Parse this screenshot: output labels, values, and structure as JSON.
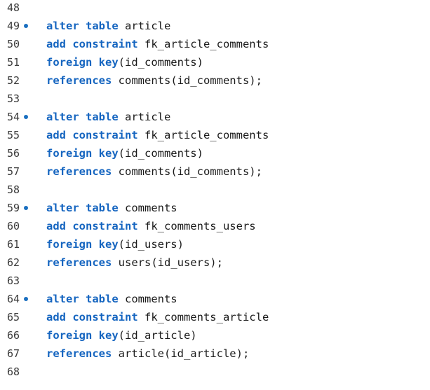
{
  "lines": [
    {
      "num": "48",
      "marker": false,
      "tokens": []
    },
    {
      "num": "49",
      "marker": true,
      "tokens": [
        {
          "t": "kw",
          "v": "alter table"
        },
        {
          "t": "id",
          "v": " article"
        }
      ]
    },
    {
      "num": "50",
      "marker": false,
      "tokens": [
        {
          "t": "kw",
          "v": "add constraint"
        },
        {
          "t": "id",
          "v": " fk_article_comments"
        }
      ]
    },
    {
      "num": "51",
      "marker": false,
      "tokens": [
        {
          "t": "kw",
          "v": "foreign key"
        },
        {
          "t": "id",
          "v": "(id_comments)"
        }
      ]
    },
    {
      "num": "52",
      "marker": false,
      "tokens": [
        {
          "t": "kw",
          "v": "references"
        },
        {
          "t": "id",
          "v": " comments(id_comments);"
        }
      ]
    },
    {
      "num": "53",
      "marker": false,
      "tokens": []
    },
    {
      "num": "54",
      "marker": true,
      "tokens": [
        {
          "t": "kw",
          "v": "alter table"
        },
        {
          "t": "id",
          "v": " article"
        }
      ]
    },
    {
      "num": "55",
      "marker": false,
      "tokens": [
        {
          "t": "kw",
          "v": "add constraint"
        },
        {
          "t": "id",
          "v": " fk_article_comments"
        }
      ]
    },
    {
      "num": "56",
      "marker": false,
      "tokens": [
        {
          "t": "kw",
          "v": "foreign key"
        },
        {
          "t": "id",
          "v": "(id_comments)"
        }
      ]
    },
    {
      "num": "57",
      "marker": false,
      "tokens": [
        {
          "t": "kw",
          "v": "references"
        },
        {
          "t": "id",
          "v": " comments(id_comments);"
        }
      ]
    },
    {
      "num": "58",
      "marker": false,
      "tokens": []
    },
    {
      "num": "59",
      "marker": true,
      "tokens": [
        {
          "t": "kw",
          "v": "alter table"
        },
        {
          "t": "id",
          "v": " comments"
        }
      ]
    },
    {
      "num": "60",
      "marker": false,
      "tokens": [
        {
          "t": "kw",
          "v": "add constraint"
        },
        {
          "t": "id",
          "v": " fk_comments_users"
        }
      ]
    },
    {
      "num": "61",
      "marker": false,
      "tokens": [
        {
          "t": "kw",
          "v": "foreign key"
        },
        {
          "t": "id",
          "v": "(id_users)"
        }
      ]
    },
    {
      "num": "62",
      "marker": false,
      "tokens": [
        {
          "t": "kw",
          "v": "references"
        },
        {
          "t": "id",
          "v": " users(id_users);"
        }
      ]
    },
    {
      "num": "63",
      "marker": false,
      "tokens": []
    },
    {
      "num": "64",
      "marker": true,
      "tokens": [
        {
          "t": "kw",
          "v": "alter table"
        },
        {
          "t": "id",
          "v": " comments"
        }
      ]
    },
    {
      "num": "65",
      "marker": false,
      "tokens": [
        {
          "t": "kw",
          "v": "add constraint"
        },
        {
          "t": "id",
          "v": " fk_comments_article"
        }
      ]
    },
    {
      "num": "66",
      "marker": false,
      "tokens": [
        {
          "t": "kw",
          "v": "foreign key"
        },
        {
          "t": "id",
          "v": "(id_article)"
        }
      ]
    },
    {
      "num": "67",
      "marker": false,
      "tokens": [
        {
          "t": "kw",
          "v": "references"
        },
        {
          "t": "id",
          "v": " article(id_article);"
        }
      ]
    },
    {
      "num": "68",
      "marker": false,
      "tokens": []
    }
  ],
  "colors": {
    "keyword": "#1565c0",
    "identifier": "#1a1a1a",
    "line_number": "#3b3b3b",
    "marker": "#1a6fc0",
    "background": "#ffffff"
  },
  "icons": {
    "marker": "breakpoint-dot-icon"
  }
}
